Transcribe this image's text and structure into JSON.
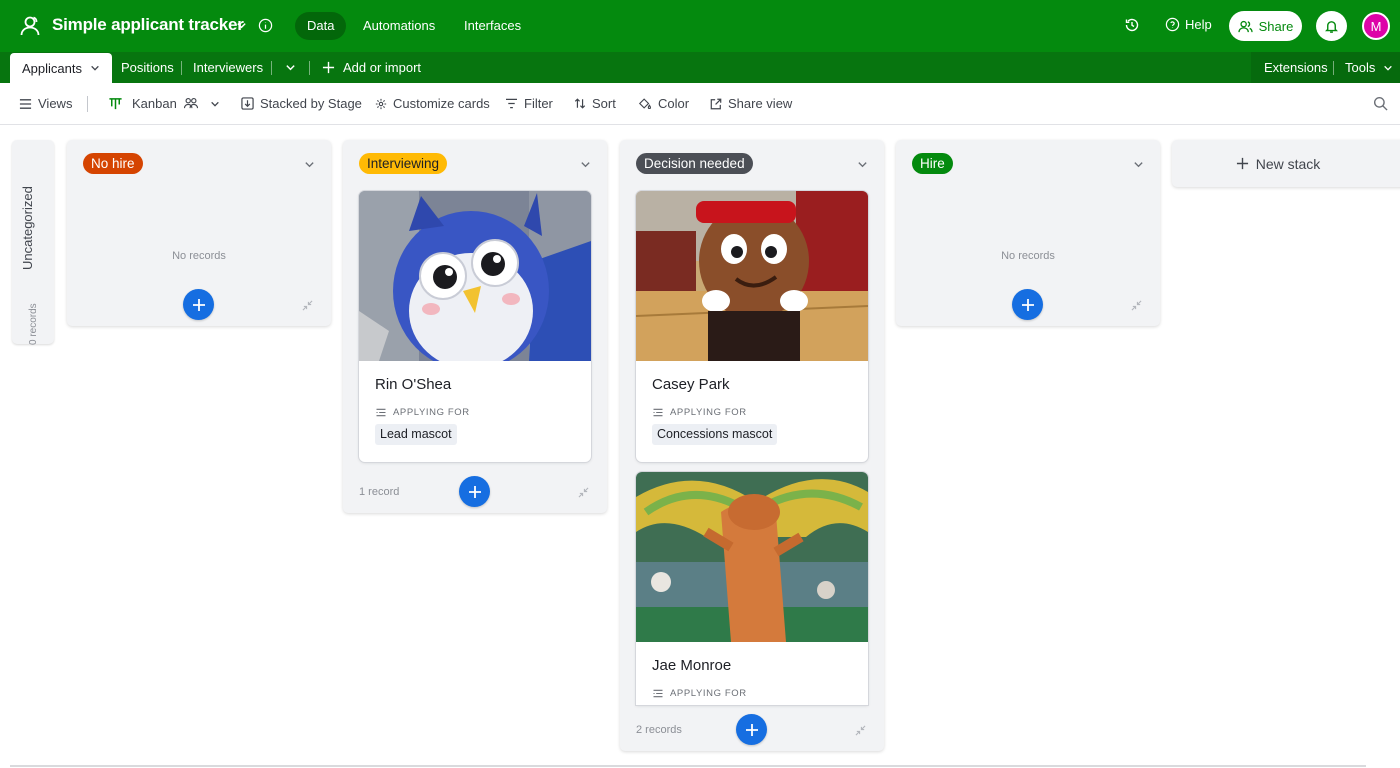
{
  "topbar": {
    "base_title": "Simple applicant tracker",
    "nav": [
      "Data",
      "Automations",
      "Interfaces"
    ],
    "help_label": "Help",
    "share_label": "Share",
    "avatar_initial": "M",
    "brand_color": "#048a0e"
  },
  "tabs": {
    "items": [
      "Applicants",
      "Positions",
      "Interviewers"
    ],
    "add_label": "Add or import",
    "extensions_label": "Extensions",
    "tools_label": "Tools"
  },
  "toolbar": {
    "views_label": "Views",
    "view_name": "Kanban",
    "stacked_label": "Stacked by Stage",
    "customize_label": "Customize cards",
    "filter_label": "Filter",
    "sort_label": "Sort",
    "color_label": "Color",
    "share_view_label": "Share view"
  },
  "board": {
    "uncategorized": {
      "label": "Uncategorized",
      "count": "0 records"
    },
    "stacks": [
      {
        "name": "No hire",
        "color": "#d54401",
        "text_color": "#ffffff",
        "empty_text": "No records"
      },
      {
        "name": "Interviewing",
        "color": "#ffba05",
        "text_color": "#1d1f25",
        "count": "1 record",
        "cards": [
          {
            "name": "Rin O'Shea",
            "field_label": "APPLYING FOR",
            "field_value": "Lead mascot"
          }
        ]
      },
      {
        "name": "Decision needed",
        "color": "#4c4f56",
        "text_color": "#ffffff",
        "count": "2 records",
        "cards": [
          {
            "name": "Casey Park",
            "field_label": "APPLYING FOR",
            "field_value": "Concessions mascot"
          },
          {
            "name": "Jae Monroe",
            "field_label": "APPLYING FOR"
          }
        ]
      },
      {
        "name": "Hire",
        "color": "#048a0e",
        "text_color": "#ffffff",
        "empty_text": "No records"
      }
    ],
    "new_stack_label": "New stack"
  }
}
